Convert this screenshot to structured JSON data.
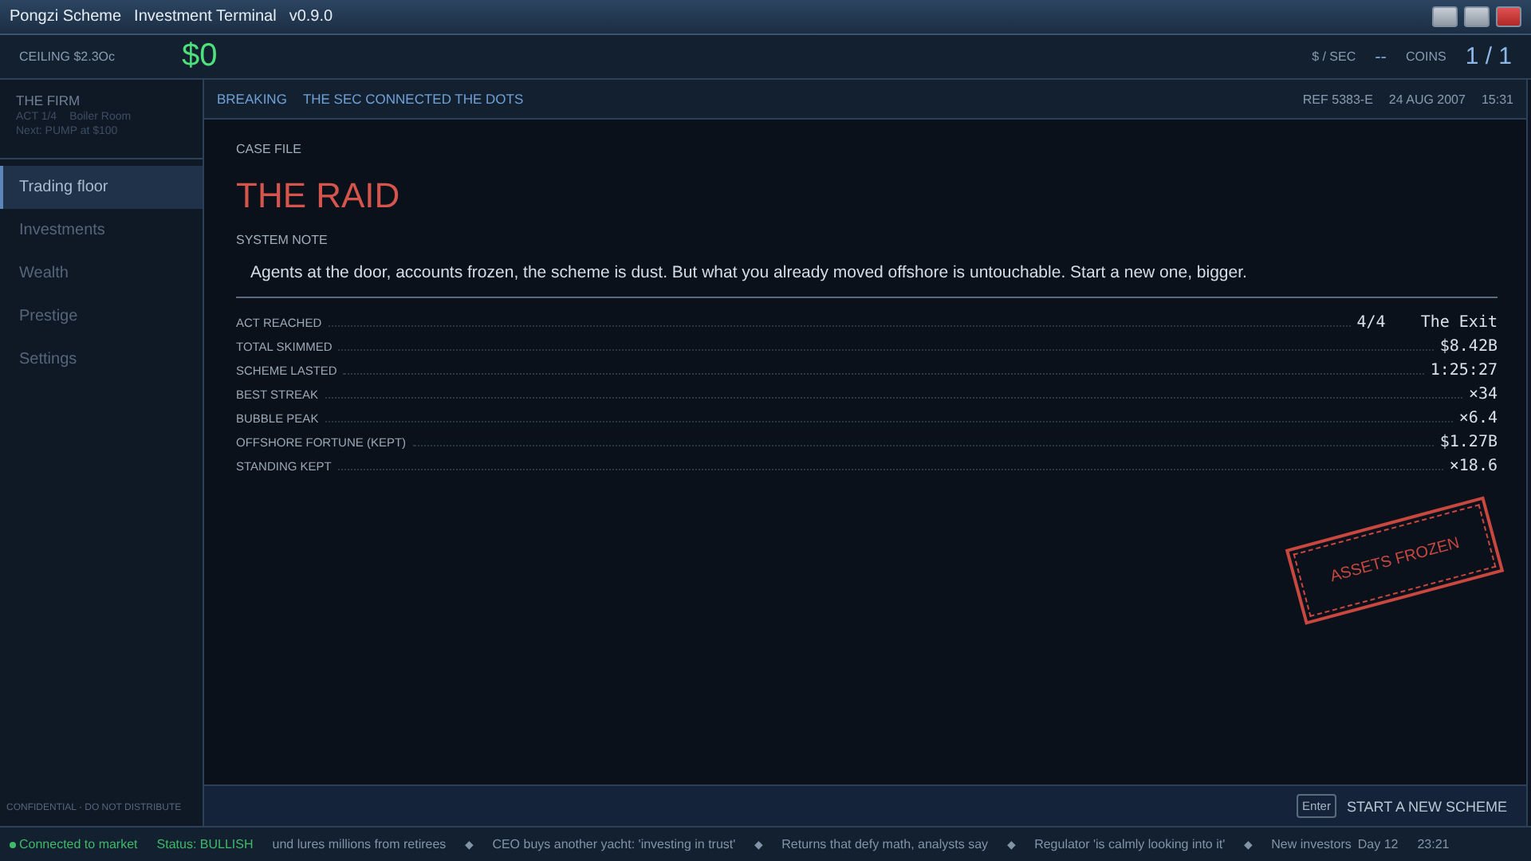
{
  "window": {
    "title": "Pongzi Scheme",
    "subtitle": "Investment Terminal",
    "version": "v0.9.0"
  },
  "topbar": {
    "ceiling": "CEILING $2.3Oc",
    "balance": "$0",
    "rate_label": "$ / SEC",
    "rate": "--",
    "coins_label": "COINS",
    "coins": "1 / 1"
  },
  "sidebar": {
    "firm": {
      "title": "THE FIRM",
      "act": "ACT 1/4",
      "stage": "Boiler Room",
      "next": "Next: PUMP at $100"
    },
    "items": [
      {
        "label": "Trading floor",
        "selected": true,
        "disabled": false
      },
      {
        "label": "Investments",
        "selected": false,
        "disabled": true
      },
      {
        "label": "Wealth",
        "selected": false,
        "disabled": true
      },
      {
        "label": "Prestige",
        "selected": false,
        "disabled": true
      },
      {
        "label": "Settings",
        "selected": false,
        "disabled": true
      }
    ],
    "footer": "CONFIDENTIAL · DO NOT DISTRIBUTE"
  },
  "news": {
    "tag": "BREAKING",
    "headline": "THE SEC CONNECTED THE DOTS",
    "ref": "REF 5383-E",
    "date": "24 AUG 2007",
    "time": "15:31"
  },
  "case": {
    "label": "CASE FILE",
    "title": "THE RAID",
    "note_label": "SYSTEM NOTE",
    "note": "Agents at the door, accounts frozen, the scheme is dust. But what you already moved offshore is untouchable. Start a new one, bigger.",
    "stats": [
      {
        "label": "ACT REACHED",
        "value": "4/4",
        "detail": "The Exit"
      },
      {
        "label": "TOTAL SKIMMED",
        "value": "$8.42B"
      },
      {
        "label": "SCHEME LASTED",
        "value": "1:25:27"
      },
      {
        "label": "BEST STREAK",
        "value": "×34"
      },
      {
        "label": "BUBBLE PEAK",
        "value": "×6.4"
      },
      {
        "label": "OFFSHORE FORTUNE (KEPT)",
        "value": "$1.27B"
      },
      {
        "label": "STANDING KEPT",
        "value": "×18.6"
      }
    ],
    "stamp": "ASSETS FROZEN"
  },
  "action": {
    "key": "Enter",
    "label": "START A NEW SCHEME"
  },
  "status_bar": {
    "connection": "Connected to market",
    "status": "Status: BULLISH",
    "separator": "◆",
    "ticker": [
      "und lures millions from retirees",
      "CEO buys another yacht: 'investing in trust'",
      "Returns that defy math, analysts say",
      "Regulator 'is calmly looking into it'",
      "New investors"
    ],
    "day": "Day 12",
    "time": "23:21"
  }
}
